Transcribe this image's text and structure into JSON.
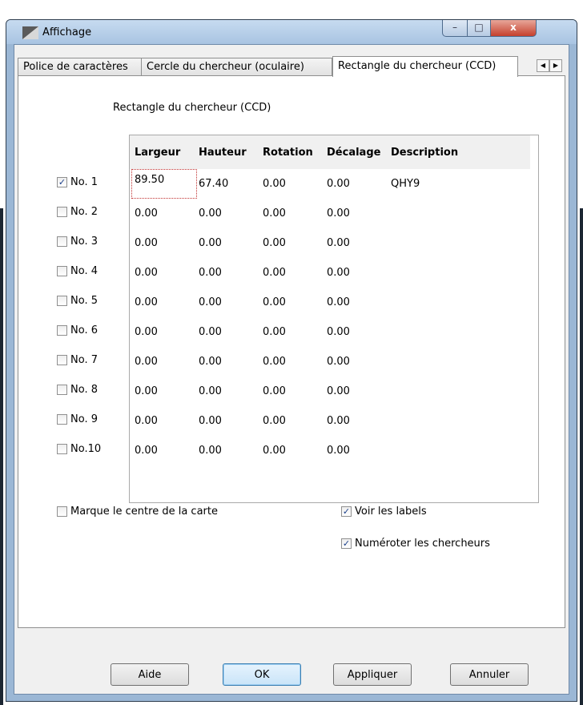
{
  "window": {
    "title": "Affichage",
    "min_glyph": "–",
    "max_glyph": "□",
    "close_glyph": "x"
  },
  "tabs": [
    {
      "label": "Police de caractères"
    },
    {
      "label": "Cercle du chercheur (oculaire)"
    },
    {
      "label": "Rectangle du chercheur (CCD)",
      "active": true
    }
  ],
  "tab_scroll": {
    "left": "◀",
    "right": "▶"
  },
  "panel": {
    "title": "Rectangle du chercheur (CCD)"
  },
  "grid": {
    "headers": [
      "Largeur",
      "Hauteur",
      "Rotation",
      "Décalage",
      "Description"
    ],
    "rows": [
      {
        "label": "No. 1",
        "checked": true,
        "check": "✓",
        "cells": [
          "89.50",
          "67.40",
          "0.00",
          "0.00",
          "QHY9"
        ]
      },
      {
        "label": "No. 2",
        "checked": false,
        "check": "",
        "cells": [
          "0.00",
          "0.00",
          "0.00",
          "0.00",
          ""
        ]
      },
      {
        "label": "No. 3",
        "checked": false,
        "check": "",
        "cells": [
          "0.00",
          "0.00",
          "0.00",
          "0.00",
          ""
        ]
      },
      {
        "label": "No. 4",
        "checked": false,
        "check": "",
        "cells": [
          "0.00",
          "0.00",
          "0.00",
          "0.00",
          ""
        ]
      },
      {
        "label": "No. 5",
        "checked": false,
        "check": "",
        "cells": [
          "0.00",
          "0.00",
          "0.00",
          "0.00",
          ""
        ]
      },
      {
        "label": "No. 6",
        "checked": false,
        "check": "",
        "cells": [
          "0.00",
          "0.00",
          "0.00",
          "0.00",
          ""
        ]
      },
      {
        "label": "No. 7",
        "checked": false,
        "check": "",
        "cells": [
          "0.00",
          "0.00",
          "0.00",
          "0.00",
          ""
        ]
      },
      {
        "label": "No. 8",
        "checked": false,
        "check": "",
        "cells": [
          "0.00",
          "0.00",
          "0.00",
          "0.00",
          ""
        ]
      },
      {
        "label": "No. 9",
        "checked": false,
        "check": "",
        "cells": [
          "0.00",
          "0.00",
          "0.00",
          "0.00",
          ""
        ]
      },
      {
        "label": "No.10",
        "checked": false,
        "check": "",
        "cells": [
          "0.00",
          "0.00",
          "0.00",
          "0.00",
          ""
        ]
      }
    ]
  },
  "options": {
    "center_mark": {
      "label": "Marque le centre de la carte",
      "checked": false,
      "check": ""
    },
    "show_labels": {
      "label": "Voir les labels",
      "checked": true,
      "check": "✓"
    },
    "number_finders": {
      "label": "Numéroter les chercheurs",
      "checked": true,
      "check": "✓"
    }
  },
  "buttons": {
    "help": "Aide",
    "ok": "OK",
    "apply": "Appliquer",
    "cancel": "Annuler"
  }
}
